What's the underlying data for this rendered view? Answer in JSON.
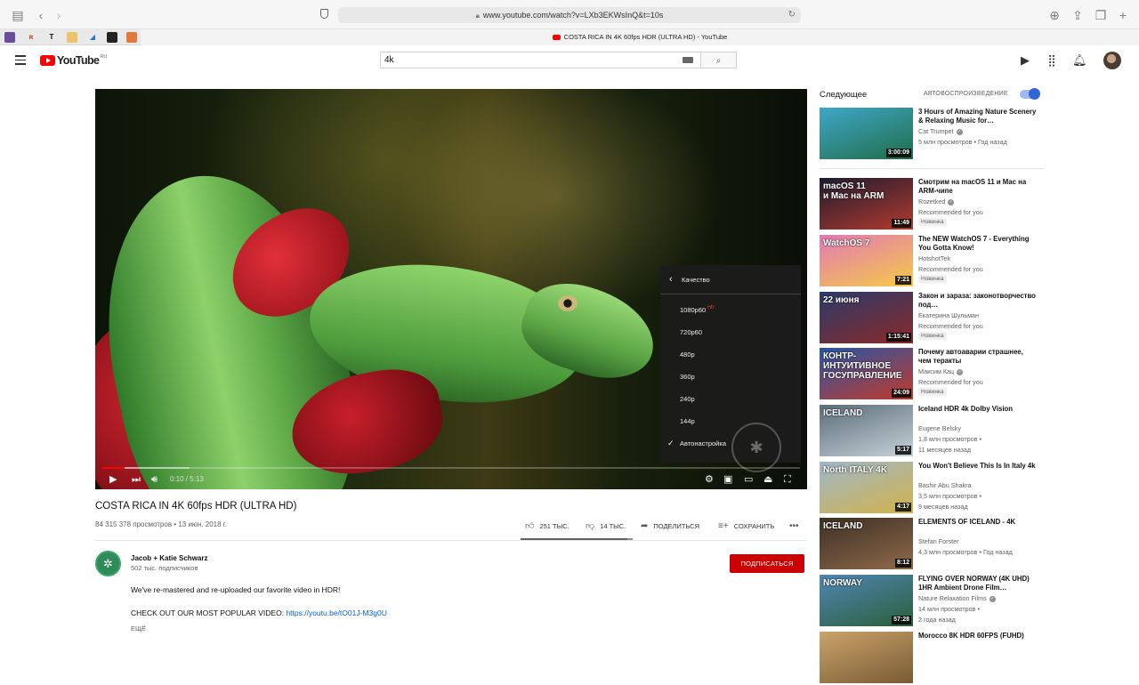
{
  "browser": {
    "url": "www.youtube.com/watch?v=LXb3EKWsInQ&t=10s",
    "tab_title": "COSTA RICA IN 4K 60fps HDR (ULTRA HD) - YouTube"
  },
  "header": {
    "logo_text": "YouTube",
    "logo_region": "RU",
    "search_value": "4k"
  },
  "player": {
    "time": "0:10 / 5:13",
    "progress_fraction": 0.032,
    "quality_menu": {
      "title": "Качество",
      "options": [
        {
          "label": "1080p60",
          "badge": "HD"
        },
        {
          "label": "720p60",
          "badge": ""
        },
        {
          "label": "480p",
          "badge": ""
        },
        {
          "label": "360p",
          "badge": ""
        },
        {
          "label": "240p",
          "badge": ""
        },
        {
          "label": "144p",
          "badge": ""
        },
        {
          "label": "Автонастройка",
          "badge": "",
          "selected": true
        }
      ]
    }
  },
  "video": {
    "title": "COSTA RICA IN 4K 60fps HDR (ULTRA HD)",
    "meta": "84 315 378 просмотров • 13 июн. 2018 г.",
    "likes": "251 ТЫС.",
    "dislikes": "14 ТЫС.",
    "like_fraction": 0.95,
    "share_label": "ПОДЕЛИТЬСЯ",
    "save_label": "СОХРАНИТЬ"
  },
  "channel": {
    "name": "Jacob + Katie Schwarz",
    "subscribers": "502 тыс. подписчиков",
    "subscribe_label": "ПОДПИСАТЬСЯ",
    "description_line1": "We've re-mastered and re-uploaded our favorite video in HDR!",
    "description_line2_prefix": "CHECK OUT OUR MOST POPULAR VIDEO: ",
    "description_link": "https://youtu.be/tO01J-M3g0U",
    "more_label": "ЕЩЁ"
  },
  "sidebar": {
    "next_title": "Следующее",
    "autoplay_label": "АВТОВОСПРОИЗВЕДЕНИЕ",
    "autoplay_on": true,
    "items": [
      {
        "title": "3 Hours of Amazing Nature Scenery & Relaxing Music for…",
        "channel": "Cat Trumpet",
        "verified": true,
        "meta": "5 млн просмотров • Год назад",
        "badge": "",
        "duration": "3:00:09",
        "overlay": "",
        "colors": [
          "#3fa6c8",
          "#1f6e4a"
        ]
      },
      {
        "title": "Смотрим на macOS 11 и Mac на ARM-чипе",
        "channel": "Rozetked",
        "verified": true,
        "meta": "Recommended for you",
        "badge": "Новинка",
        "duration": "11:49",
        "overlay": "macOS 11\nи Mac на ARM",
        "colors": [
          "#1c1c2e",
          "#b33a2f"
        ]
      },
      {
        "title": "The NEW WatchOS 7 - Everything You Gotta Know!",
        "channel": "HotshotTek",
        "verified": false,
        "meta": "Recommended for you",
        "badge": "Новинка",
        "duration": "7:21",
        "overlay": "WatchOS 7",
        "colors": [
          "#e07ab5",
          "#f6c948"
        ]
      },
      {
        "title": "Закон и зараза: законотворчество под…",
        "channel": "Екатерина Шульман",
        "verified": false,
        "meta": "Recommended for you",
        "badge": "Новинка",
        "duration": "1:15:41",
        "overlay": "22 июня",
        "colors": [
          "#2a3a6a",
          "#8a2a2a"
        ]
      },
      {
        "title": "Почему автоаварии страшнее, чем теракты",
        "channel": "Максим Кац",
        "verified": true,
        "meta": "Recommended for you",
        "badge": "Новинка",
        "duration": "24:09",
        "overlay": "КОНТР-ИНТУИТИВНОЕ ГОСУПРАВЛЕНИЕ",
        "colors": [
          "#2855a8",
          "#c23a2a"
        ]
      },
      {
        "title": "Iceland HDR 4k Dolby Vision",
        "channel": "Eugene Belsky",
        "verified": false,
        "meta": "1,8 млн просмотров •",
        "meta2": "11 месяцев назад",
        "badge": "",
        "duration": "5:17",
        "overlay": "ICELAND",
        "colors": [
          "#5a6d7a",
          "#c8d2d8"
        ]
      },
      {
        "title": "You Won't Believe This Is In Italy 4k",
        "channel": "Bashir Abu Shakra",
        "verified": false,
        "meta": "3,5 млн просмотров •",
        "meta2": "9 месяцев назад",
        "badge": "",
        "duration": "4:17",
        "overlay": "North ITALY 4K",
        "colors": [
          "#9fb7c9",
          "#d1b24a"
        ]
      },
      {
        "title": "ELEMENTS OF ICELAND - 4K",
        "channel": "Stefan Forster",
        "verified": false,
        "meta": "4,3 млн просмотров • Год назад",
        "badge": "",
        "duration": "8:12",
        "overlay": "ICELAND",
        "colors": [
          "#3c2f25",
          "#8f6a4a"
        ]
      },
      {
        "title": "FLYING OVER NORWAY (4K UHD) 1HR Ambient Drone Film…",
        "channel": "Nature Relaxation Films",
        "verified": true,
        "meta": "14 млн просмотров •",
        "meta2": "2 года назад",
        "badge": "",
        "duration": "57:28",
        "overlay": "NORWAY",
        "colors": [
          "#4f86b5",
          "#2b5f3a"
        ]
      },
      {
        "title": "Morocco 8K HDR 60FPS (FUHD)",
        "channel": "",
        "verified": false,
        "meta": "",
        "badge": "",
        "duration": "",
        "overlay": "",
        "colors": [
          "#c9a46a",
          "#7a5a34"
        ]
      }
    ]
  }
}
